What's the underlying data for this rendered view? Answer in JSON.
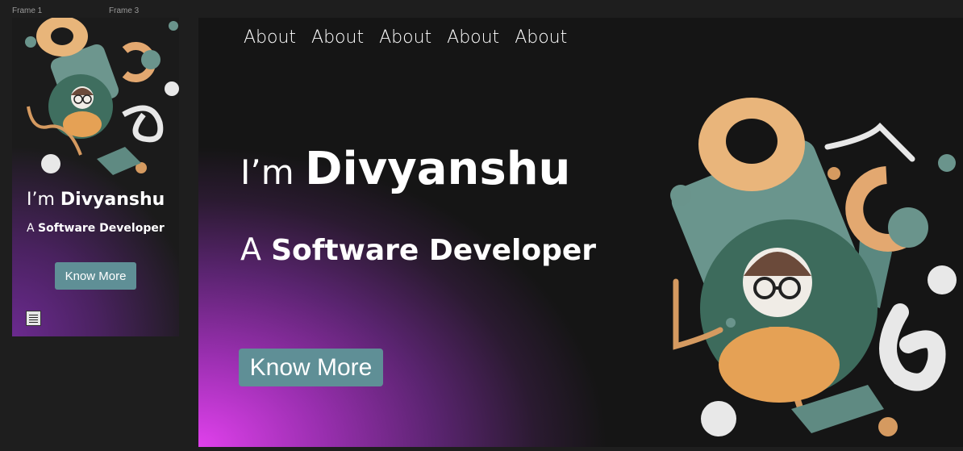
{
  "canvas": {
    "frame1_label": "Frame 1",
    "frame3_label": "Frame 3"
  },
  "mobile": {
    "greeting_prefix": "I’m ",
    "name": "Divyanshu",
    "role_prefix": "A ",
    "role": "Software Developer",
    "cta_label": "Know More",
    "menu_icon": "menu-icon"
  },
  "desktop": {
    "nav": [
      "About",
      "About",
      "About",
      "About",
      "About"
    ],
    "greeting_prefix": "I’m ",
    "name": "Divyanshu",
    "role_prefix": "A ",
    "role": "Software Developer",
    "cta_label": "Know More"
  },
  "colors": {
    "accent_button": "#5f8f96",
    "gradient_magenta": "#e040ec",
    "background": "#151515",
    "art_teal": "#5e8a82",
    "art_orange": "#e8a860"
  }
}
